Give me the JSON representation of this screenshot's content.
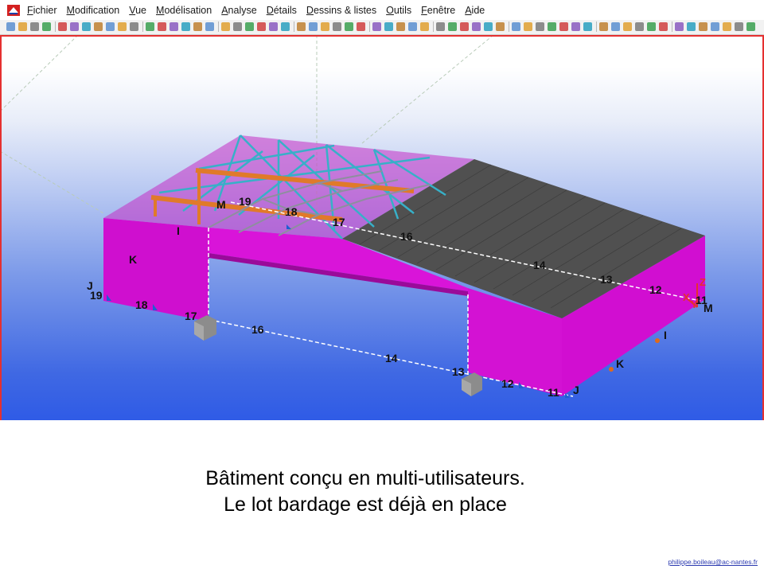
{
  "menubar": {
    "items": [
      {
        "mnemonic": "F",
        "rest": "ichier"
      },
      {
        "mnemonic": "M",
        "rest": "odification"
      },
      {
        "mnemonic": "V",
        "rest": "ue"
      },
      {
        "mnemonic": "M",
        "rest": "odélisation"
      },
      {
        "mnemonic": "A",
        "rest": "nalyse"
      },
      {
        "mnemonic": "D",
        "rest": "étails"
      },
      {
        "mnemonic": "D",
        "rest": "essins & listes"
      },
      {
        "mnemonic": "O",
        "rest": "utils"
      },
      {
        "mnemonic": "F",
        "rest": "enêtre"
      },
      {
        "mnemonic": "A",
        "rest": "ide"
      }
    ]
  },
  "viewport": {
    "grid_labels": {
      "j_left": "J",
      "k_left": "K",
      "i_top": "I",
      "m_top": "M",
      "n19_left": "19",
      "n18_left": "18",
      "n17_left": "17",
      "n19_top": "19",
      "n18_top": "18",
      "n17_top": "17",
      "n16_top": "16",
      "n14_top": "14",
      "n13_top": "13",
      "n12_top": "12",
      "n11_top": "11",
      "n16_bottom": "16",
      "n14_bottom": "14",
      "n13_bottom": "13",
      "n12_bottom": "12",
      "n11_bottom": "11",
      "j_right": "J",
      "k_right": "K",
      "i_right": "I",
      "m_right": "M"
    },
    "axes": {
      "x": "X",
      "y": "Y",
      "z": "Z"
    },
    "colors": {
      "cladding": "#d90fd9",
      "roof": "#4a4a4a",
      "steel_primary": "#e07a2a",
      "steel_secondary": "#37b0c8",
      "grid_line": "#ffffff",
      "footing": "#8c8c8c"
    }
  },
  "caption": {
    "line1": "Bâtiment conçu en multi-utilisateurs.",
    "line2": "Le lot bardage est déjà en place"
  },
  "footer": {
    "email": "philippe.boileau@ac-nantes.fr"
  }
}
